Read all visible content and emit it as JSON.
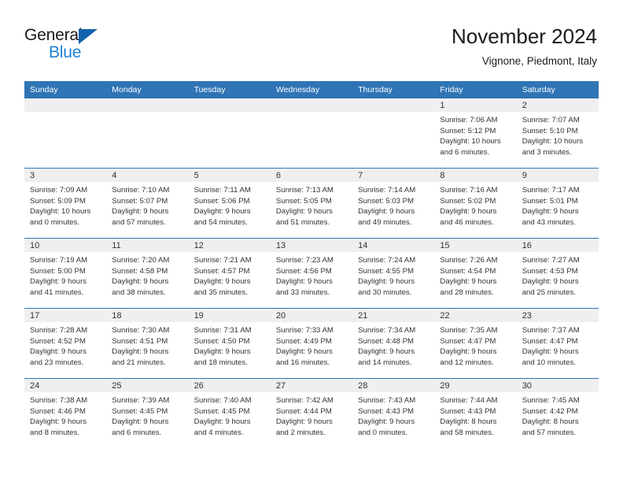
{
  "brand": {
    "name_part1": "General",
    "name_part2": "Blue",
    "triangle_color": "#1062ad",
    "blue_color": "#1f7fd4"
  },
  "header": {
    "title": "November 2024",
    "subtitle": "Vignone, Piedmont, Italy"
  },
  "theme": {
    "header_bg": "#2f74b5",
    "header_text": "#ffffff",
    "daynum_band_bg": "#efefef",
    "body_text": "#333333",
    "page_bg": "#ffffff"
  },
  "columns": [
    "Sunday",
    "Monday",
    "Tuesday",
    "Wednesday",
    "Thursday",
    "Friday",
    "Saturday"
  ],
  "labels": {
    "sunrise_prefix": "Sunrise:",
    "sunset_prefix": "Sunset:",
    "daylight_prefix": "Daylight:"
  },
  "weeks": [
    [
      {
        "empty": true
      },
      {
        "empty": true
      },
      {
        "empty": true
      },
      {
        "empty": true
      },
      {
        "empty": true
      },
      {
        "day": "1",
        "sunrise": "Sunrise: 7:06 AM",
        "sunset": "Sunset: 5:12 PM",
        "daylight_line1": "Daylight: 10 hours",
        "daylight_line2": "and 6 minutes."
      },
      {
        "day": "2",
        "sunrise": "Sunrise: 7:07 AM",
        "sunset": "Sunset: 5:10 PM",
        "daylight_line1": "Daylight: 10 hours",
        "daylight_line2": "and 3 minutes."
      }
    ],
    [
      {
        "day": "3",
        "sunrise": "Sunrise: 7:09 AM",
        "sunset": "Sunset: 5:09 PM",
        "daylight_line1": "Daylight: 10 hours",
        "daylight_line2": "and 0 minutes."
      },
      {
        "day": "4",
        "sunrise": "Sunrise: 7:10 AM",
        "sunset": "Sunset: 5:07 PM",
        "daylight_line1": "Daylight: 9 hours",
        "daylight_line2": "and 57 minutes."
      },
      {
        "day": "5",
        "sunrise": "Sunrise: 7:11 AM",
        "sunset": "Sunset: 5:06 PM",
        "daylight_line1": "Daylight: 9 hours",
        "daylight_line2": "and 54 minutes."
      },
      {
        "day": "6",
        "sunrise": "Sunrise: 7:13 AM",
        "sunset": "Sunset: 5:05 PM",
        "daylight_line1": "Daylight: 9 hours",
        "daylight_line2": "and 51 minutes."
      },
      {
        "day": "7",
        "sunrise": "Sunrise: 7:14 AM",
        "sunset": "Sunset: 5:03 PM",
        "daylight_line1": "Daylight: 9 hours",
        "daylight_line2": "and 49 minutes."
      },
      {
        "day": "8",
        "sunrise": "Sunrise: 7:16 AM",
        "sunset": "Sunset: 5:02 PM",
        "daylight_line1": "Daylight: 9 hours",
        "daylight_line2": "and 46 minutes."
      },
      {
        "day": "9",
        "sunrise": "Sunrise: 7:17 AM",
        "sunset": "Sunset: 5:01 PM",
        "daylight_line1": "Daylight: 9 hours",
        "daylight_line2": "and 43 minutes."
      }
    ],
    [
      {
        "day": "10",
        "sunrise": "Sunrise: 7:19 AM",
        "sunset": "Sunset: 5:00 PM",
        "daylight_line1": "Daylight: 9 hours",
        "daylight_line2": "and 41 minutes."
      },
      {
        "day": "11",
        "sunrise": "Sunrise: 7:20 AM",
        "sunset": "Sunset: 4:58 PM",
        "daylight_line1": "Daylight: 9 hours",
        "daylight_line2": "and 38 minutes."
      },
      {
        "day": "12",
        "sunrise": "Sunrise: 7:21 AM",
        "sunset": "Sunset: 4:57 PM",
        "daylight_line1": "Daylight: 9 hours",
        "daylight_line2": "and 35 minutes."
      },
      {
        "day": "13",
        "sunrise": "Sunrise: 7:23 AM",
        "sunset": "Sunset: 4:56 PM",
        "daylight_line1": "Daylight: 9 hours",
        "daylight_line2": "and 33 minutes."
      },
      {
        "day": "14",
        "sunrise": "Sunrise: 7:24 AM",
        "sunset": "Sunset: 4:55 PM",
        "daylight_line1": "Daylight: 9 hours",
        "daylight_line2": "and 30 minutes."
      },
      {
        "day": "15",
        "sunrise": "Sunrise: 7:26 AM",
        "sunset": "Sunset: 4:54 PM",
        "daylight_line1": "Daylight: 9 hours",
        "daylight_line2": "and 28 minutes."
      },
      {
        "day": "16",
        "sunrise": "Sunrise: 7:27 AM",
        "sunset": "Sunset: 4:53 PM",
        "daylight_line1": "Daylight: 9 hours",
        "daylight_line2": "and 25 minutes."
      }
    ],
    [
      {
        "day": "17",
        "sunrise": "Sunrise: 7:28 AM",
        "sunset": "Sunset: 4:52 PM",
        "daylight_line1": "Daylight: 9 hours",
        "daylight_line2": "and 23 minutes."
      },
      {
        "day": "18",
        "sunrise": "Sunrise: 7:30 AM",
        "sunset": "Sunset: 4:51 PM",
        "daylight_line1": "Daylight: 9 hours",
        "daylight_line2": "and 21 minutes."
      },
      {
        "day": "19",
        "sunrise": "Sunrise: 7:31 AM",
        "sunset": "Sunset: 4:50 PM",
        "daylight_line1": "Daylight: 9 hours",
        "daylight_line2": "and 18 minutes."
      },
      {
        "day": "20",
        "sunrise": "Sunrise: 7:33 AM",
        "sunset": "Sunset: 4:49 PM",
        "daylight_line1": "Daylight: 9 hours",
        "daylight_line2": "and 16 minutes."
      },
      {
        "day": "21",
        "sunrise": "Sunrise: 7:34 AM",
        "sunset": "Sunset: 4:48 PM",
        "daylight_line1": "Daylight: 9 hours",
        "daylight_line2": "and 14 minutes."
      },
      {
        "day": "22",
        "sunrise": "Sunrise: 7:35 AM",
        "sunset": "Sunset: 4:47 PM",
        "daylight_line1": "Daylight: 9 hours",
        "daylight_line2": "and 12 minutes."
      },
      {
        "day": "23",
        "sunrise": "Sunrise: 7:37 AM",
        "sunset": "Sunset: 4:47 PM",
        "daylight_line1": "Daylight: 9 hours",
        "daylight_line2": "and 10 minutes."
      }
    ],
    [
      {
        "day": "24",
        "sunrise": "Sunrise: 7:38 AM",
        "sunset": "Sunset: 4:46 PM",
        "daylight_line1": "Daylight: 9 hours",
        "daylight_line2": "and 8 minutes."
      },
      {
        "day": "25",
        "sunrise": "Sunrise: 7:39 AM",
        "sunset": "Sunset: 4:45 PM",
        "daylight_line1": "Daylight: 9 hours",
        "daylight_line2": "and 6 minutes."
      },
      {
        "day": "26",
        "sunrise": "Sunrise: 7:40 AM",
        "sunset": "Sunset: 4:45 PM",
        "daylight_line1": "Daylight: 9 hours",
        "daylight_line2": "and 4 minutes."
      },
      {
        "day": "27",
        "sunrise": "Sunrise: 7:42 AM",
        "sunset": "Sunset: 4:44 PM",
        "daylight_line1": "Daylight: 9 hours",
        "daylight_line2": "and 2 minutes."
      },
      {
        "day": "28",
        "sunrise": "Sunrise: 7:43 AM",
        "sunset": "Sunset: 4:43 PM",
        "daylight_line1": "Daylight: 9 hours",
        "daylight_line2": "and 0 minutes."
      },
      {
        "day": "29",
        "sunrise": "Sunrise: 7:44 AM",
        "sunset": "Sunset: 4:43 PM",
        "daylight_line1": "Daylight: 8 hours",
        "daylight_line2": "and 58 minutes."
      },
      {
        "day": "30",
        "sunrise": "Sunrise: 7:45 AM",
        "sunset": "Sunset: 4:42 PM",
        "daylight_line1": "Daylight: 8 hours",
        "daylight_line2": "and 57 minutes."
      }
    ]
  ]
}
